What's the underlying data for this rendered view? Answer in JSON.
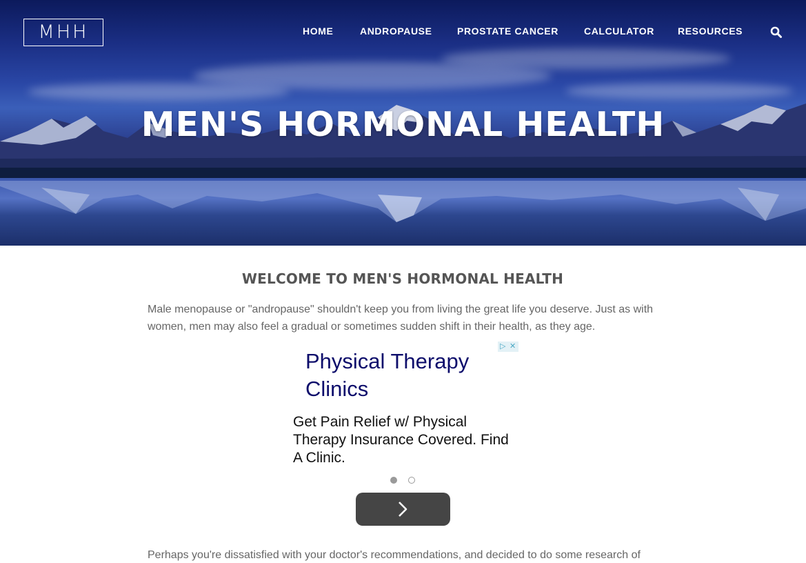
{
  "site": {
    "logo": "MHH"
  },
  "nav": {
    "items": [
      {
        "label": "HOME"
      },
      {
        "label": "ANDROPAUSE"
      },
      {
        "label": "PROSTATE CANCER"
      },
      {
        "label": "CALCULATOR"
      },
      {
        "label": "RESOURCES"
      }
    ],
    "search_icon": "search-icon"
  },
  "hero": {
    "title": "MEN'S HORMONAL HEALTH"
  },
  "main": {
    "heading": "WELCOME TO MEN'S HORMONAL HEALTH",
    "intro": "Male menopause or \"andropause\" shouldn't keep you from living the great life you deserve. Just as with women, men may also feel a gradual or sometimes sudden shift in their health, as they age.",
    "paragraph2": "Perhaps you're dissatisfied with your doctor's recommendations, and decided to do some research of"
  },
  "ad": {
    "headline": "Physical Therapy Clinics",
    "body": "Get Pain Relief w/ Physical Therapy Insurance Covered. Find A Clinic.",
    "carousel_dots": 2,
    "active_dot": 1,
    "next_icon": "chevron-right-icon",
    "adchoices_icons": [
      "play-triangle-icon",
      "close-icon"
    ]
  },
  "colors": {
    "hero_sky": "#1b2f85",
    "ad_headline": "#0d0d6b",
    "ad_button": "#454545",
    "heading_text": "#555555",
    "body_text": "#666666"
  }
}
